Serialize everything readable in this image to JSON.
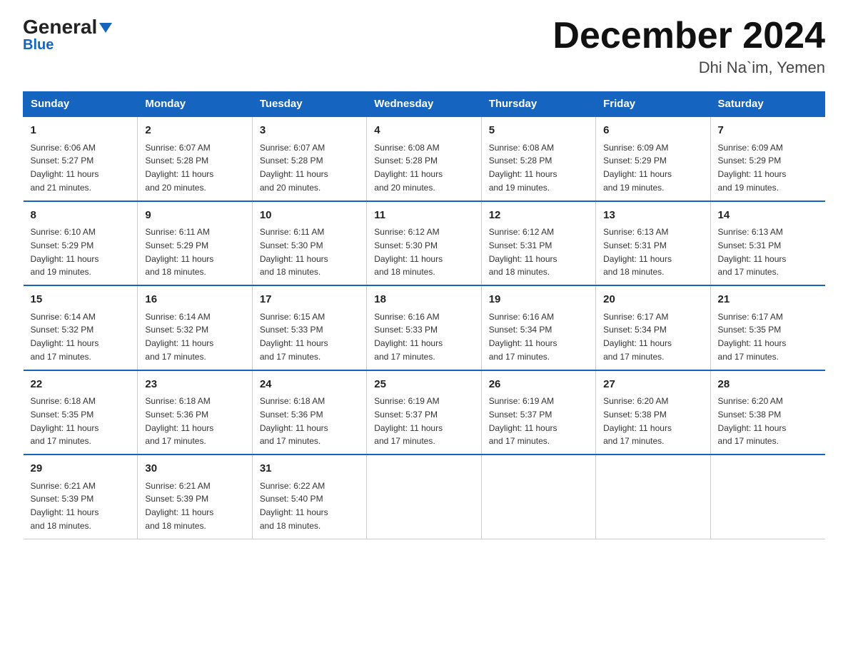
{
  "header": {
    "logo_general": "General",
    "logo_blue": "Blue",
    "month_title": "December 2024",
    "location": "Dhi Na`im, Yemen"
  },
  "days_of_week": [
    "Sunday",
    "Monday",
    "Tuesday",
    "Wednesday",
    "Thursday",
    "Friday",
    "Saturday"
  ],
  "weeks": [
    [
      {
        "day": "1",
        "sunrise": "6:06 AM",
        "sunset": "5:27 PM",
        "daylight": "11 hours and 21 minutes."
      },
      {
        "day": "2",
        "sunrise": "6:07 AM",
        "sunset": "5:28 PM",
        "daylight": "11 hours and 20 minutes."
      },
      {
        "day": "3",
        "sunrise": "6:07 AM",
        "sunset": "5:28 PM",
        "daylight": "11 hours and 20 minutes."
      },
      {
        "day": "4",
        "sunrise": "6:08 AM",
        "sunset": "5:28 PM",
        "daylight": "11 hours and 20 minutes."
      },
      {
        "day": "5",
        "sunrise": "6:08 AM",
        "sunset": "5:28 PM",
        "daylight": "11 hours and 19 minutes."
      },
      {
        "day": "6",
        "sunrise": "6:09 AM",
        "sunset": "5:29 PM",
        "daylight": "11 hours and 19 minutes."
      },
      {
        "day": "7",
        "sunrise": "6:09 AM",
        "sunset": "5:29 PM",
        "daylight": "11 hours and 19 minutes."
      }
    ],
    [
      {
        "day": "8",
        "sunrise": "6:10 AM",
        "sunset": "5:29 PM",
        "daylight": "11 hours and 19 minutes."
      },
      {
        "day": "9",
        "sunrise": "6:11 AM",
        "sunset": "5:29 PM",
        "daylight": "11 hours and 18 minutes."
      },
      {
        "day": "10",
        "sunrise": "6:11 AM",
        "sunset": "5:30 PM",
        "daylight": "11 hours and 18 minutes."
      },
      {
        "day": "11",
        "sunrise": "6:12 AM",
        "sunset": "5:30 PM",
        "daylight": "11 hours and 18 minutes."
      },
      {
        "day": "12",
        "sunrise": "6:12 AM",
        "sunset": "5:31 PM",
        "daylight": "11 hours and 18 minutes."
      },
      {
        "day": "13",
        "sunrise": "6:13 AM",
        "sunset": "5:31 PM",
        "daylight": "11 hours and 18 minutes."
      },
      {
        "day": "14",
        "sunrise": "6:13 AM",
        "sunset": "5:31 PM",
        "daylight": "11 hours and 17 minutes."
      }
    ],
    [
      {
        "day": "15",
        "sunrise": "6:14 AM",
        "sunset": "5:32 PM",
        "daylight": "11 hours and 17 minutes."
      },
      {
        "day": "16",
        "sunrise": "6:14 AM",
        "sunset": "5:32 PM",
        "daylight": "11 hours and 17 minutes."
      },
      {
        "day": "17",
        "sunrise": "6:15 AM",
        "sunset": "5:33 PM",
        "daylight": "11 hours and 17 minutes."
      },
      {
        "day": "18",
        "sunrise": "6:16 AM",
        "sunset": "5:33 PM",
        "daylight": "11 hours and 17 minutes."
      },
      {
        "day": "19",
        "sunrise": "6:16 AM",
        "sunset": "5:34 PM",
        "daylight": "11 hours and 17 minutes."
      },
      {
        "day": "20",
        "sunrise": "6:17 AM",
        "sunset": "5:34 PM",
        "daylight": "11 hours and 17 minutes."
      },
      {
        "day": "21",
        "sunrise": "6:17 AM",
        "sunset": "5:35 PM",
        "daylight": "11 hours and 17 minutes."
      }
    ],
    [
      {
        "day": "22",
        "sunrise": "6:18 AM",
        "sunset": "5:35 PM",
        "daylight": "11 hours and 17 minutes."
      },
      {
        "day": "23",
        "sunrise": "6:18 AM",
        "sunset": "5:36 PM",
        "daylight": "11 hours and 17 minutes."
      },
      {
        "day": "24",
        "sunrise": "6:18 AM",
        "sunset": "5:36 PM",
        "daylight": "11 hours and 17 minutes."
      },
      {
        "day": "25",
        "sunrise": "6:19 AM",
        "sunset": "5:37 PM",
        "daylight": "11 hours and 17 minutes."
      },
      {
        "day": "26",
        "sunrise": "6:19 AM",
        "sunset": "5:37 PM",
        "daylight": "11 hours and 17 minutes."
      },
      {
        "day": "27",
        "sunrise": "6:20 AM",
        "sunset": "5:38 PM",
        "daylight": "11 hours and 17 minutes."
      },
      {
        "day": "28",
        "sunrise": "6:20 AM",
        "sunset": "5:38 PM",
        "daylight": "11 hours and 17 minutes."
      }
    ],
    [
      {
        "day": "29",
        "sunrise": "6:21 AM",
        "sunset": "5:39 PM",
        "daylight": "11 hours and 18 minutes."
      },
      {
        "day": "30",
        "sunrise": "6:21 AM",
        "sunset": "5:39 PM",
        "daylight": "11 hours and 18 minutes."
      },
      {
        "day": "31",
        "sunrise": "6:22 AM",
        "sunset": "5:40 PM",
        "daylight": "11 hours and 18 minutes."
      },
      null,
      null,
      null,
      null
    ]
  ],
  "labels": {
    "sunrise": "Sunrise:",
    "sunset": "Sunset:",
    "daylight": "Daylight:"
  }
}
